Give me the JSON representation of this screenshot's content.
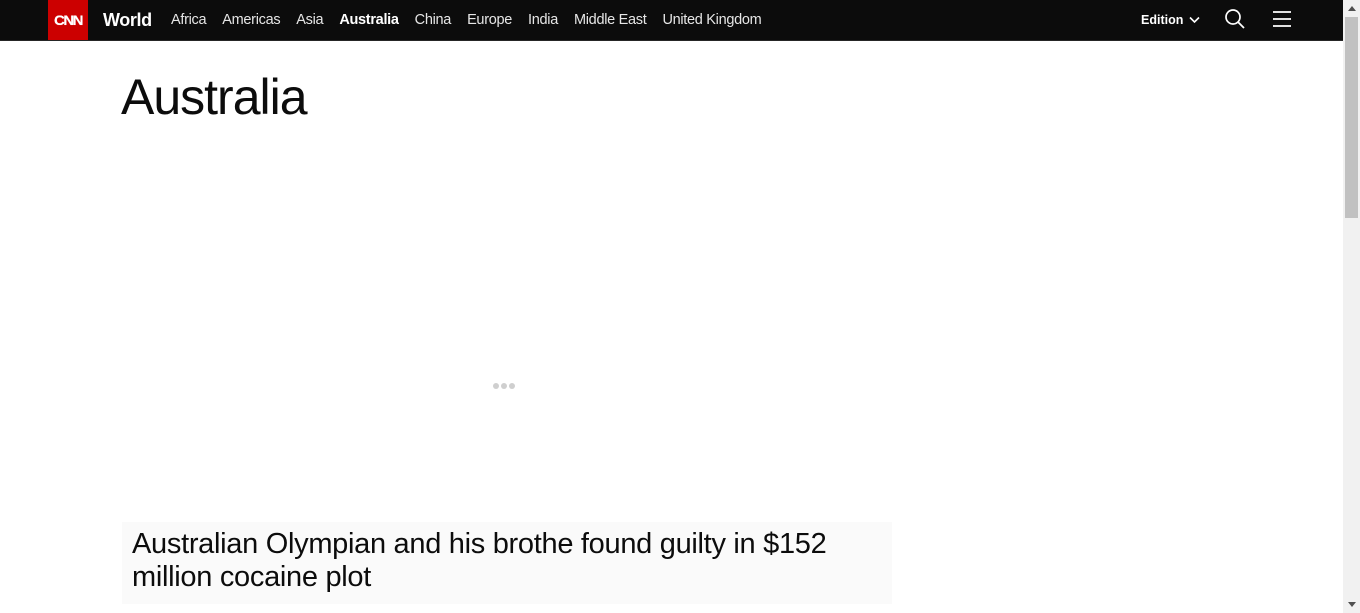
{
  "header": {
    "logo": "CNN",
    "section": "World",
    "nav_links": [
      "Africa",
      "Americas",
      "Asia",
      "Australia",
      "China",
      "Europe",
      "India",
      "Middle East",
      "United Kingdom"
    ],
    "active_link": "Australia",
    "edition_label": "Edition",
    "icons": [
      "chevron-down-icon",
      "search-icon",
      "hamburger-menu-icon"
    ]
  },
  "main": {
    "page_title": "Australia",
    "loading_indicator": "three-dots",
    "headline": "Australian Olympian and his brothe found guilty in $152 million cocaine plot"
  },
  "colors": {
    "nav_background": "#0c0c0c",
    "brand_red": "#cc0000",
    "page_background": "#ffffff",
    "card_background": "#fafafa"
  }
}
